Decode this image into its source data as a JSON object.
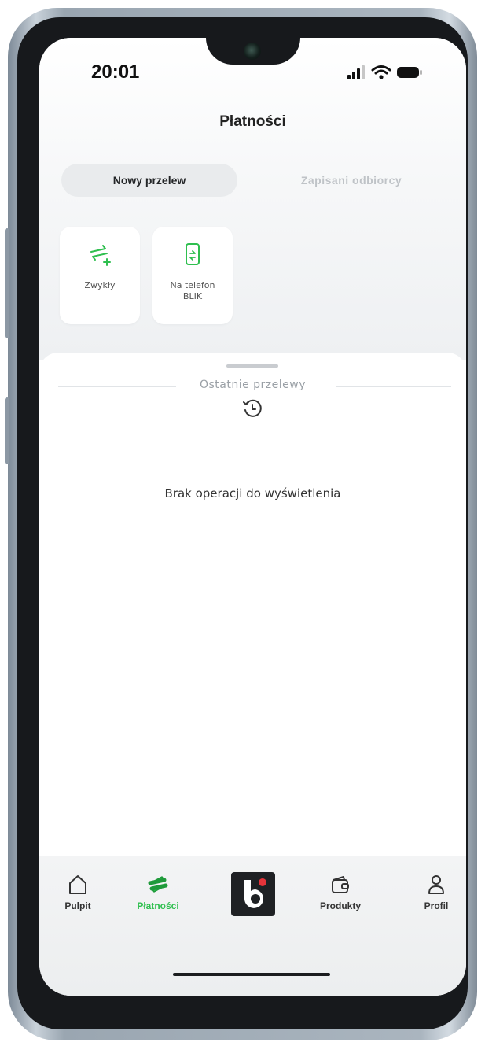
{
  "status_bar": {
    "time": "20:01"
  },
  "header": {
    "title": "Płatności"
  },
  "tabs": [
    {
      "label": "Nowy przelew",
      "active": true
    },
    {
      "label": "Zapisani odbiorcy",
      "active": false
    }
  ],
  "transfer_types": [
    {
      "label": "Zwykły",
      "icon": "transfer-arrows-plus-icon"
    },
    {
      "label": "Na telefon\nBLIK",
      "icon": "phone-blik-icon"
    }
  ],
  "recent": {
    "title": "Ostatnie przelewy",
    "icon": "history-clock-icon",
    "empty_text": "Brak operacji do wyświetlenia"
  },
  "bottom_nav": [
    {
      "label": "Pulpit",
      "icon": "home-icon",
      "active": false
    },
    {
      "label": "Płatności",
      "icon": "transfer-arrows-icon",
      "active": true
    },
    {
      "label": "",
      "icon": "brand-logo-icon",
      "active": false
    },
    {
      "label": "Produkty",
      "icon": "wallet-icon",
      "active": false
    },
    {
      "label": "Profil",
      "icon": "user-icon",
      "active": false
    }
  ],
  "colors": {
    "accent": "#2fbf4f",
    "brand_red": "#e6343a",
    "text_primary": "#222222",
    "text_muted": "#9aa0a6"
  }
}
